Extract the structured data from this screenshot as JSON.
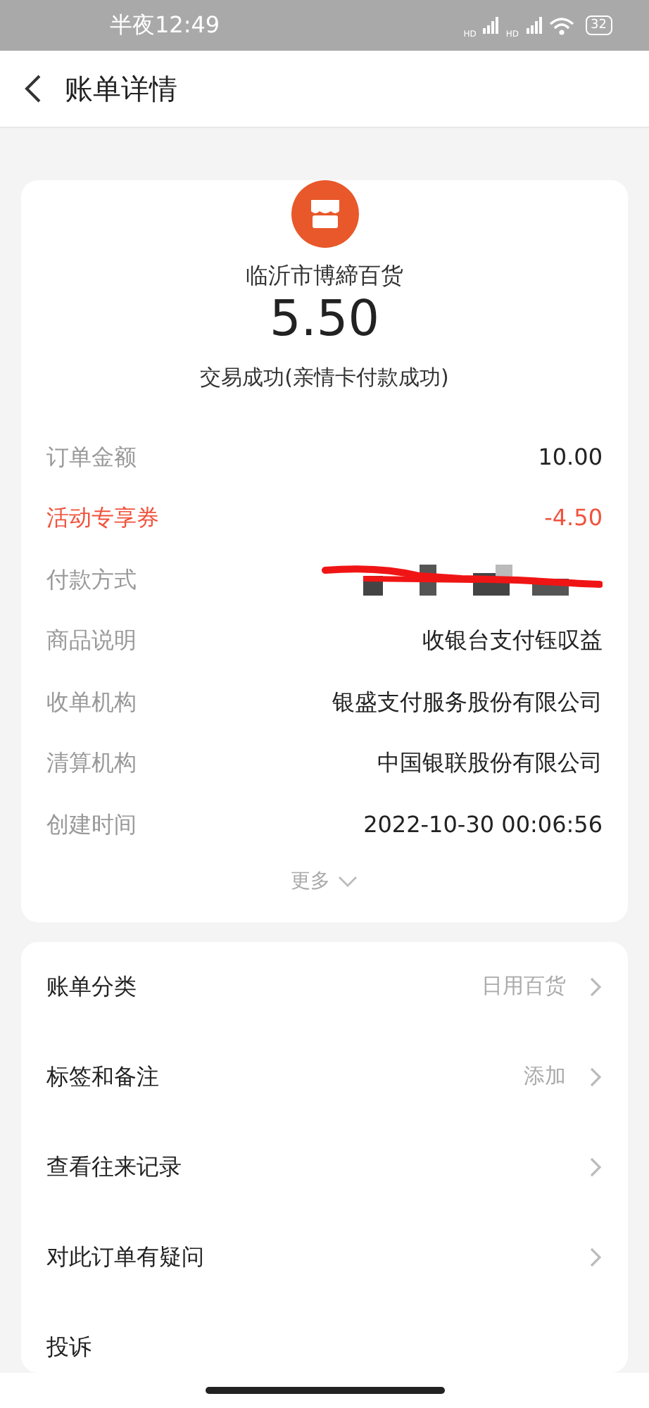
{
  "status_bar": {
    "time": "半夜12:49",
    "signal_labels": [
      "HD",
      "HD"
    ],
    "battery": "32"
  },
  "header": {
    "title": "账单详情"
  },
  "summary": {
    "merchant": "临沂市博締百货",
    "amount": "5.50",
    "status": "交易成功(亲情卡付款成功)"
  },
  "details": [
    {
      "kind": "plain",
      "label": "订单金额",
      "value": "10.00"
    },
    {
      "kind": "highlight",
      "label": "活动专享券",
      "value": "-4.50"
    },
    {
      "kind": "redacted",
      "label": "付款方式"
    },
    {
      "kind": "plain",
      "label": "商品说明",
      "value": "收银台支付钰叹益"
    },
    {
      "kind": "plain",
      "label": "收单机构",
      "value": "银盛支付服务股份有限公司"
    },
    {
      "kind": "plain",
      "label": "清算机构",
      "value": "中国银联股份有限公司"
    },
    {
      "kind": "plain",
      "label": "创建时间",
      "value": "2022-10-30 00:06:56"
    }
  ],
  "more": "更多",
  "menu": [
    {
      "label": "账单分类",
      "value": "日用百货",
      "chevron": true
    },
    {
      "label": "标签和备注",
      "value": "添加",
      "chevron": true
    },
    {
      "label": "查看往来记录",
      "chevron": true
    },
    {
      "label": "对此订单有疑问",
      "chevron": true
    },
    {
      "label": "投诉",
      "chevron": false
    }
  ]
}
